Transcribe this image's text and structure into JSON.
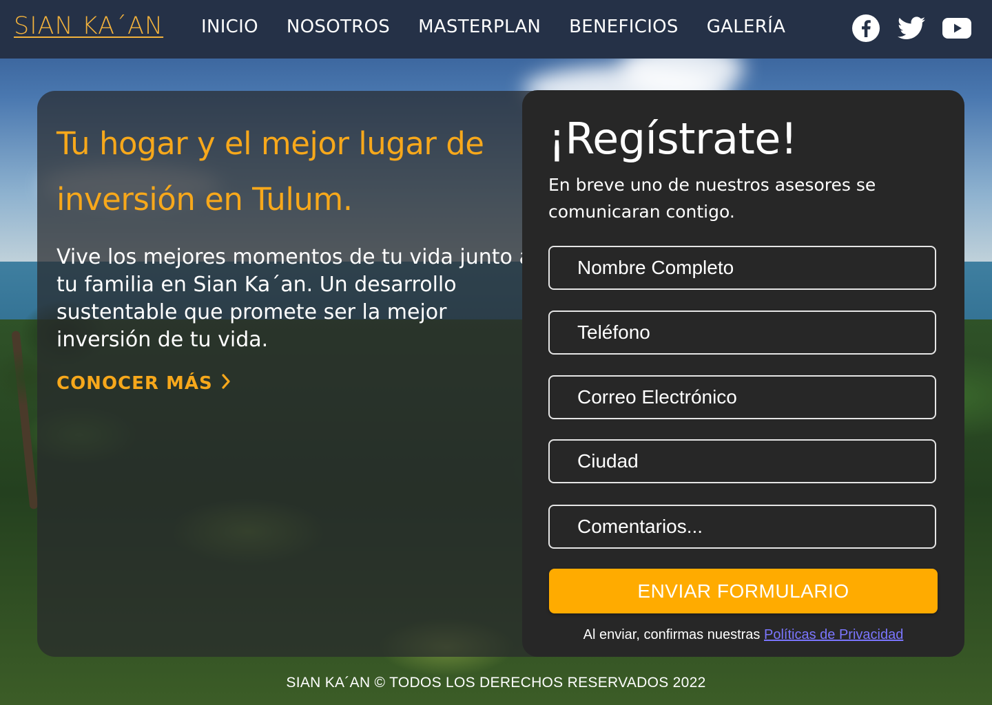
{
  "header": {
    "logo": "SIAN KA´AN",
    "nav": [
      "INICIO",
      "NOSOTROS",
      "MASTERPLAN",
      "BENEFICIOS",
      "GALERÍA"
    ],
    "social": [
      "facebook-icon",
      "twitter-icon",
      "youtube-icon"
    ]
  },
  "hero": {
    "title": "Tu hogar y el mejor lugar de inversión en Tulum.",
    "text": "Vive los mejores momentos de tu vida junto a tu familia en Sian Ka´an. Un desarrollo sustentable que promete ser la mejor inversión de tu vida.",
    "link_label": "CONOCER  MÁS",
    "link_icon": "chevron-right-icon"
  },
  "register": {
    "title": "¡Regístrate!",
    "subtitle": "En breve uno de nuestros asesores se comunicaran contigo.",
    "fields": {
      "name_placeholder": "Nombre Completo",
      "phone_placeholder": "Teléfono",
      "email_placeholder": "Correo Electrónico",
      "city_placeholder": "Ciudad",
      "comments_placeholder": "Comentarios..."
    },
    "submit_label": "ENVIAR FORMULARIO",
    "policy_text": "Al enviar, confirmas nuestras ",
    "policy_link": "Políticas de Privacidad"
  },
  "footer": {
    "text": "SIAN KA´AN © TODOS LOS DERECHOS RESERVADOS 2022"
  },
  "colors": {
    "accent": "#f7a81b",
    "button": "#ffab00",
    "header_bg": "#253147",
    "panel_bg": "#272727",
    "link": "#7b76ff"
  }
}
